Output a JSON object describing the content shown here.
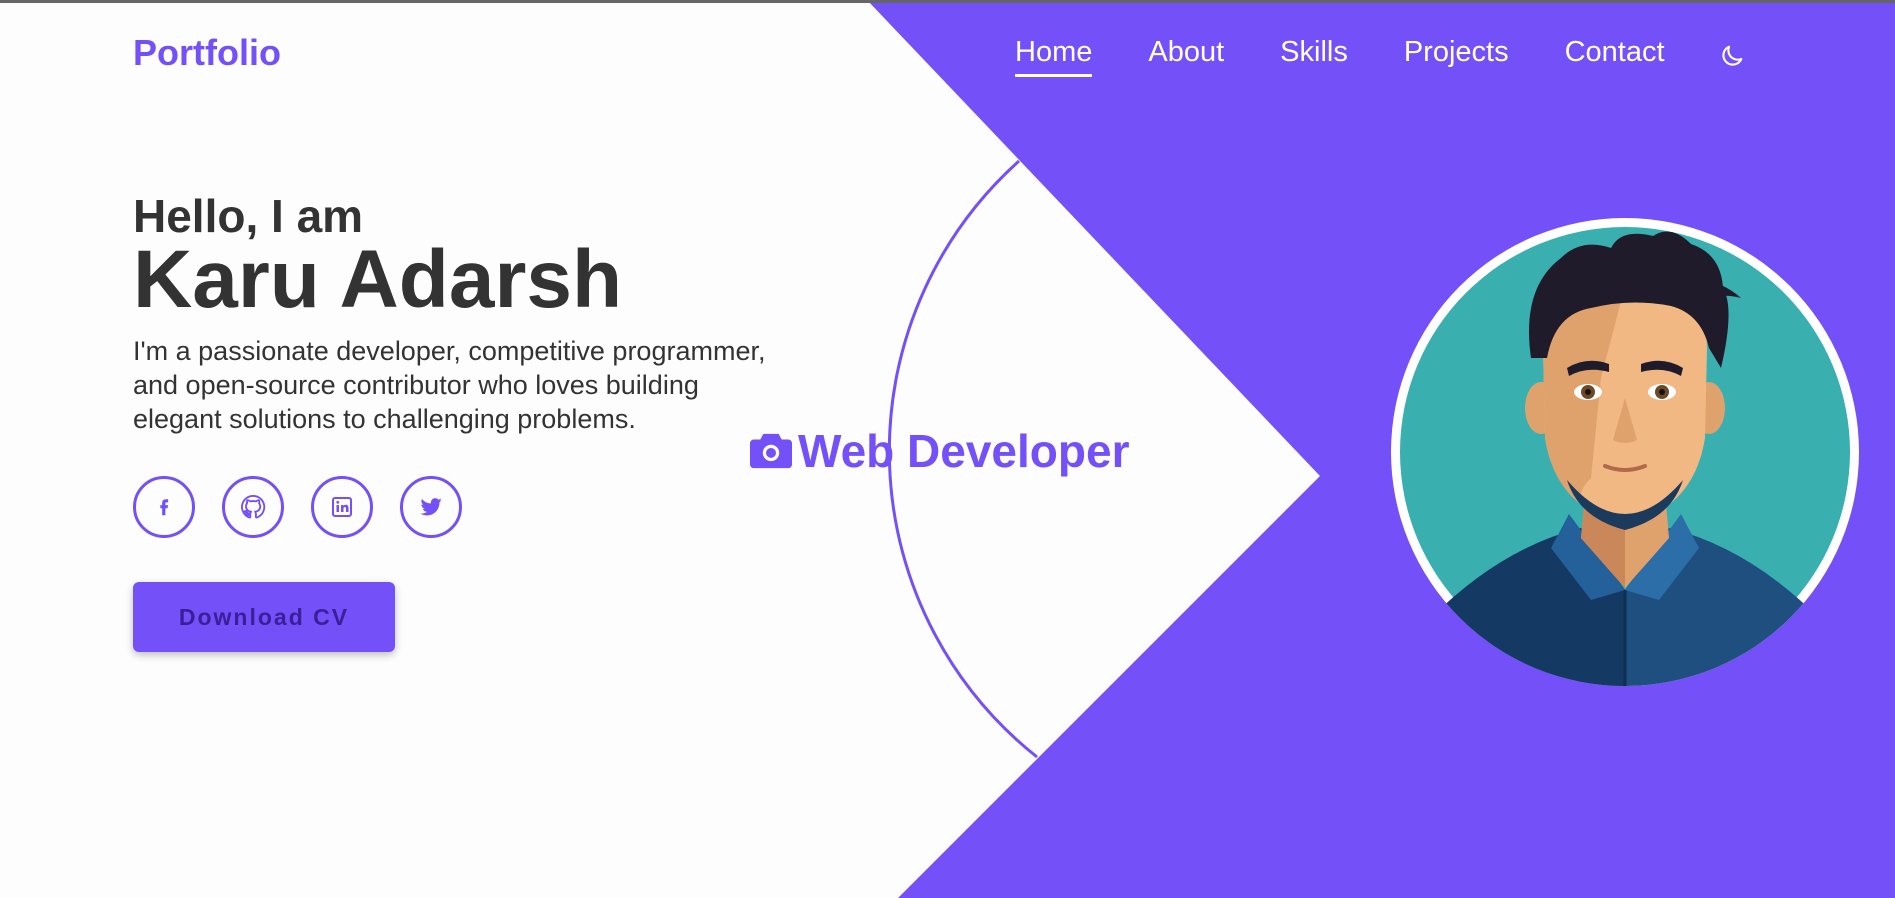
{
  "brand": {
    "logo": "Portfolio"
  },
  "nav": {
    "items": [
      {
        "label": "Home",
        "active": true
      },
      {
        "label": "About"
      },
      {
        "label": "Skills"
      },
      {
        "label": "Projects"
      },
      {
        "label": "Contact"
      }
    ],
    "theme_toggle_icon": "moon-icon"
  },
  "hero": {
    "greeting": "Hello, I am",
    "name": "Karu Adarsh",
    "bio": "I'm a passionate developer, competitive programmer, and open-source contributor who loves building elegant solutions to challenging problems.",
    "socials": [
      "facebook-icon",
      "github-icon",
      "linkedin-icon",
      "twitter-icon"
    ],
    "cta_label": "Download CV"
  },
  "role": {
    "icon": "camera-icon",
    "title": "Web Developer"
  },
  "colors": {
    "accent": "#7350f8",
    "text": "#333333",
    "background": "#fdfdfd",
    "avatar_bg": "#3aafb0"
  }
}
